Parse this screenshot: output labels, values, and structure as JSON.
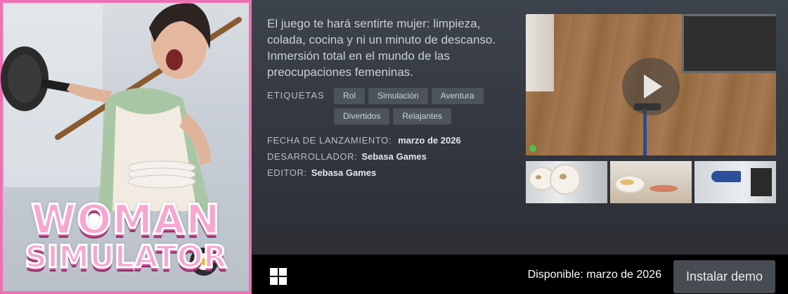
{
  "game": {
    "logo_line1": "WOMAN",
    "logo_line2": "SIMULATOR",
    "description": "El juego te hará sentirte mujer: limpieza, colada, cocina y ni un minuto de descanso. Inmersión total en el mundo de las preocupaciones femeninas."
  },
  "tags": {
    "label": "ETIQUETAS",
    "items": [
      "Rol",
      "Simulación",
      "Aventura",
      "Divertidos",
      "Relajantes"
    ]
  },
  "details": {
    "release_label": "FECHA DE LANZAMIENTO:",
    "release_value": "marzo de 2026",
    "developer_label": "DESARROLLADOR:",
    "developer_value": "Sebasa Games",
    "publisher_label": "EDITOR:",
    "publisher_value": "Sebasa Games"
  },
  "media": {
    "video_icon": "play-icon",
    "thumbnails": [
      "screenshot-dishes",
      "screenshot-kitchen",
      "screenshot-ironing"
    ]
  },
  "purchase": {
    "platform_icon": "windows-icon",
    "availability": "Disponible: marzo de 2026",
    "demo_button": "Instalar demo"
  },
  "colors": {
    "background": "#33373f",
    "tag_bg": "#4c535c",
    "bar_bg": "#000000",
    "button_bg": "#474b52",
    "logo_pink": "#f7a7cf"
  }
}
